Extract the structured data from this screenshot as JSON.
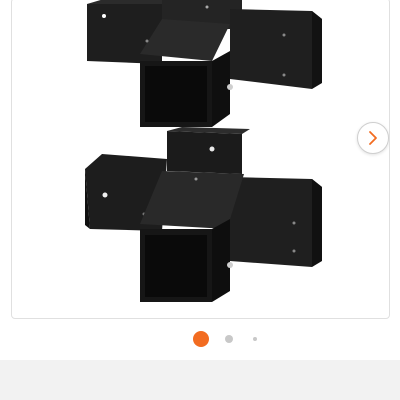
{
  "gallery": {
    "image_alt": "",
    "active_index": 1,
    "slide_count": 3,
    "next_icon": "chevron-right-icon"
  },
  "colors": {
    "accent": "#f26c21",
    "dot_inactive": "#c8c8c8",
    "product": "#1c1c1c",
    "background": "#ffffff",
    "footer": "#f2f2f2"
  }
}
